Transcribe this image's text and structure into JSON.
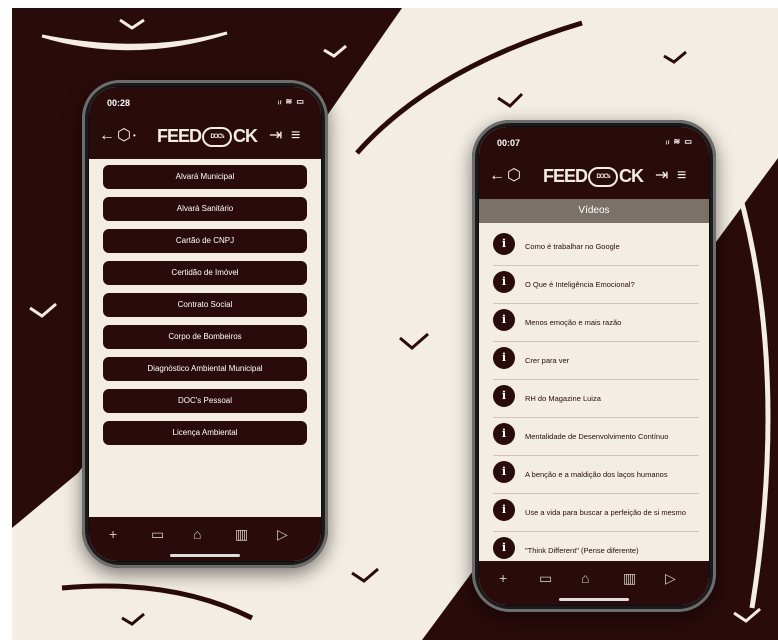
{
  "phone1": {
    "status_time": "00:28",
    "status_icons": "ᵢₗ ≋ ▭",
    "logo_left": "FEED",
    "logo_mid": "DOC's",
    "logo_right": "CK",
    "doc_items": [
      "Alvará Municipal",
      "Alvará Sanitário",
      "Cartão de CNPJ",
      "Certidão de Imóvel",
      "Contrato Social",
      "Corpo de Bombeiros",
      "Diagnóstico Ambiental Municipal",
      "DOC's Pessoal",
      "Licença Ambiental"
    ]
  },
  "phone2": {
    "status_time": "00:07",
    "status_icons": "ᵢₗ ≋ ▭",
    "logo_left": "FEED",
    "logo_mid": "DOC's",
    "logo_right": "CK",
    "section_title": "Vídeos",
    "info_glyph": "i",
    "videos": [
      "Como é trabalhar no Google",
      "O Que é Inteligência Emocional?",
      "Menos emoção e mais razão",
      "Crer para ver",
      "RH do Magazine Luiza",
      "Mentalidade de Desenvolvimento Contínuo",
      "A benção e a maldição dos laços humanos",
      "Use a vida para buscar a perfeição de si mesmo",
      "\"Think Different\" (Pense diferente)"
    ]
  },
  "colors": {
    "brand": "#2a0b0b",
    "cream": "#f3ede3",
    "header_gray": "#7a7268"
  },
  "icons": [
    "back-arrow-icon",
    "cube-icon",
    "logout-icon",
    "menu-icon",
    "plus-icon",
    "chat-icon",
    "home-icon",
    "book-icon",
    "play-icon",
    "info-icon"
  ]
}
